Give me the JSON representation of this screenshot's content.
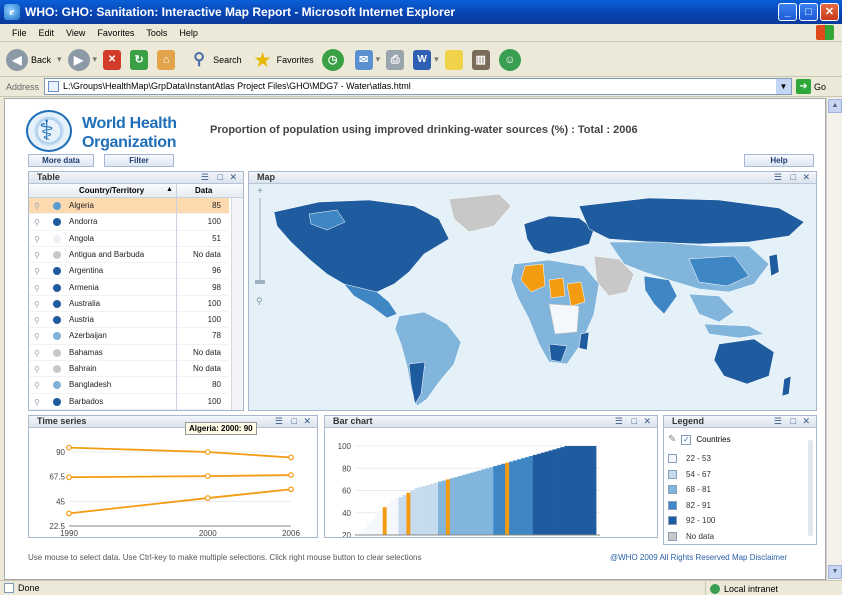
{
  "window": {
    "title": "WHO: GHO: Sanitation: Interactive Map Report - Microsoft Internet Explorer",
    "minimize": "_",
    "maximize": "□",
    "close": "✕"
  },
  "menu": [
    "File",
    "Edit",
    "View",
    "Favorites",
    "Tools",
    "Help"
  ],
  "toolbar": {
    "back": "Back",
    "search": "Search",
    "favorites": "Favorites"
  },
  "address": {
    "label": "Address",
    "value": "L:\\Groups\\HealthMap\\GrpData\\InstantAtlas Project Files\\GHO\\MDG7 - Water\\atlas.html",
    "go": "Go"
  },
  "header": {
    "org_line1": "World Health",
    "org_line2": "Organization",
    "report_title": "Proportion of population using improved drinking-water sources (%) : Total :  2006",
    "more_data": "More data",
    "filter": "Filter",
    "help": "Help"
  },
  "table": {
    "title": "Table",
    "col_country": "Country/Territory",
    "col_data": "Data",
    "rows": [
      {
        "name": "Algeria",
        "value": "85",
        "color": "#5b9bd0",
        "selected": true
      },
      {
        "name": "Andorra",
        "value": "100",
        "color": "#1f5b9e",
        "selected": false
      },
      {
        "name": "Angola",
        "value": "51",
        "color": "#eef2f8",
        "selected": false
      },
      {
        "name": "Antigua and Barbuda",
        "value": "No data",
        "color": "#c8c8c8",
        "selected": false
      },
      {
        "name": "Argentina",
        "value": "96",
        "color": "#1f5b9e",
        "selected": false
      },
      {
        "name": "Armenia",
        "value": "98",
        "color": "#1f5b9e",
        "selected": false
      },
      {
        "name": "Australia",
        "value": "100",
        "color": "#1f5b9e",
        "selected": false
      },
      {
        "name": "Austria",
        "value": "100",
        "color": "#1f5b9e",
        "selected": false
      },
      {
        "name": "Azerbaijan",
        "value": "78",
        "color": "#7fb0d8",
        "selected": false
      },
      {
        "name": "Bahamas",
        "value": "No data",
        "color": "#c8c8c8",
        "selected": false
      },
      {
        "name": "Bahrain",
        "value": "No data",
        "color": "#c8c8c8",
        "selected": false
      },
      {
        "name": "Bangladesh",
        "value": "80",
        "color": "#7fb0d8",
        "selected": false
      },
      {
        "name": "Barbados",
        "value": "100",
        "color": "#1f5b9e",
        "selected": false
      }
    ]
  },
  "map": {
    "title": "Map"
  },
  "timeseries": {
    "title": "Time series",
    "tooltip": "Algeria: 2000: 90",
    "y_ticks": [
      "90",
      "67.5",
      "45",
      "22.5"
    ],
    "x_ticks": [
      "1990",
      "2000",
      "2006"
    ]
  },
  "barchart": {
    "title": "Bar chart",
    "y_ticks": [
      "100",
      "80",
      "60",
      "40",
      "20"
    ]
  },
  "legend": {
    "title": "Legend",
    "layer": "Countries",
    "classes": [
      {
        "label": "22 - 53",
        "color": "#f4f7fb"
      },
      {
        "label": "54 - 67",
        "color": "#c6dbee"
      },
      {
        "label": "68 - 81",
        "color": "#82b5dc"
      },
      {
        "label": "82 - 91",
        "color": "#3e86c4"
      },
      {
        "label": "92 - 100",
        "color": "#1e5c9f"
      },
      {
        "label": "No data",
        "color": "#c8c8c8"
      }
    ]
  },
  "footer": {
    "instructions": "Use mouse to select data.  Use Ctrl-key to make multiple selections.  Click right mouse button to clear selections",
    "copyright": "@WHO 2009  All Rights Reserved  Map Disclaimer"
  },
  "status": {
    "left": "Done",
    "zone": "Local intranet"
  },
  "colors": {
    "selection": "#f39c12",
    "accent": "#1f6fb8"
  },
  "chart_data": [
    {
      "type": "line",
      "title": "Time series",
      "x": [
        1990,
        2000,
        2006
      ],
      "ylim": [
        22.5,
        90
      ],
      "series": [
        {
          "values": [
            94,
            90,
            85
          ]
        },
        {
          "values": [
            67,
            68,
            69
          ]
        },
        {
          "values": [
            34,
            48,
            56
          ]
        }
      ]
    },
    {
      "type": "bar",
      "title": "Bar chart",
      "ylim": [
        20,
        100
      ],
      "values": [
        22,
        26,
        30,
        34,
        38,
        42,
        45,
        48,
        51,
        53,
        54,
        56,
        58,
        60,
        62,
        63,
        64,
        65,
        66,
        67,
        68,
        69,
        70,
        71,
        72,
        73,
        74,
        75,
        76,
        77,
        78,
        79,
        80,
        81,
        82,
        83,
        84,
        85,
        86,
        87,
        88,
        89,
        90,
        91,
        92,
        93,
        94,
        95,
        96,
        97,
        98,
        99,
        100,
        100,
        100,
        100,
        100,
        100,
        100,
        100
      ],
      "selected_indices": [
        6,
        12,
        22,
        37
      ]
    }
  ]
}
